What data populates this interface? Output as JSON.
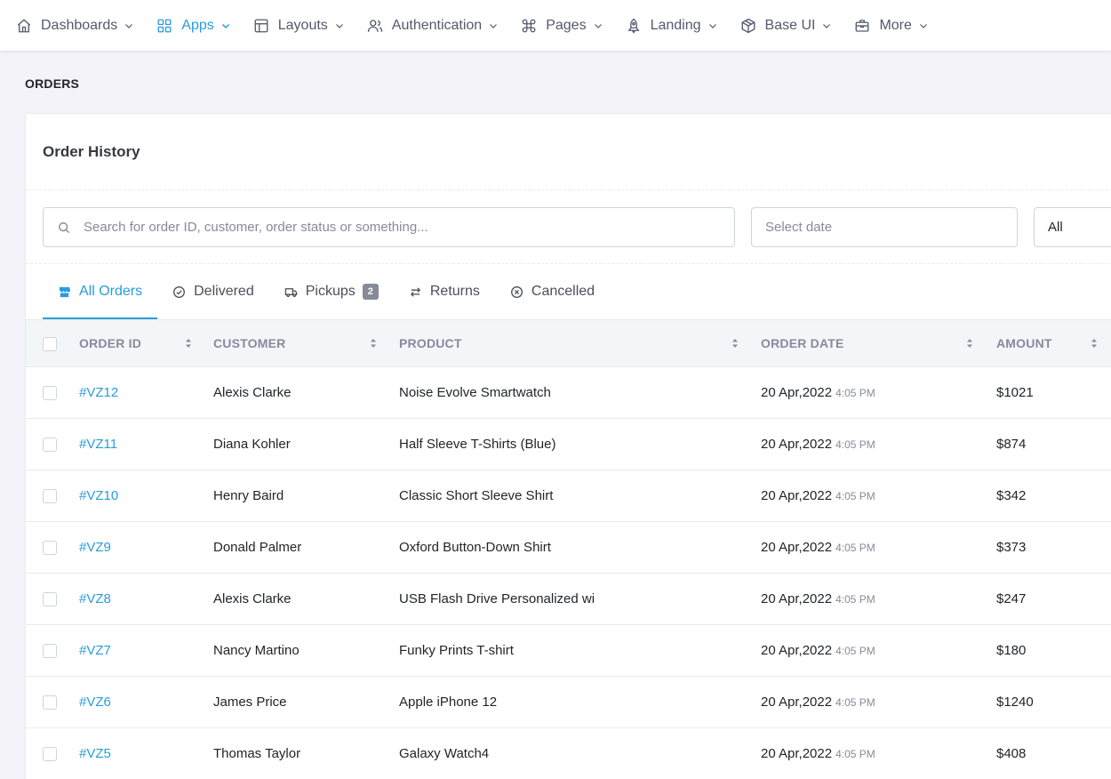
{
  "nav": {
    "items": [
      {
        "label": "Dashboards",
        "icon": "home-icon",
        "active": false
      },
      {
        "label": "Apps",
        "icon": "grid-icon",
        "active": true
      },
      {
        "label": "Layouts",
        "icon": "layout-icon",
        "active": false
      },
      {
        "label": "Authentication",
        "icon": "users-icon",
        "active": false
      },
      {
        "label": "Pages",
        "icon": "command-icon",
        "active": false
      },
      {
        "label": "Landing",
        "icon": "rocket-icon",
        "active": false
      },
      {
        "label": "Base UI",
        "icon": "cube-icon",
        "active": false
      },
      {
        "label": "More",
        "icon": "briefcase-icon",
        "active": false
      }
    ]
  },
  "page": {
    "title": "ORDERS"
  },
  "card": {
    "title": "Order History"
  },
  "filters": {
    "search_placeholder": "Search for order ID, customer, order status or something...",
    "date_placeholder": "Select date",
    "status_value": "All"
  },
  "tabs": [
    {
      "label": "All Orders",
      "icon": "store-icon",
      "active": true
    },
    {
      "label": "Delivered",
      "icon": "check-circle-icon",
      "active": false
    },
    {
      "label": "Pickups",
      "icon": "truck-icon",
      "active": false,
      "badge": "2"
    },
    {
      "label": "Returns",
      "icon": "arrow-left-right-icon",
      "active": false
    },
    {
      "label": "Cancelled",
      "icon": "close-circle-icon",
      "active": false
    }
  ],
  "table": {
    "columns": [
      "ORDER ID",
      "CUSTOMER",
      "PRODUCT",
      "ORDER DATE",
      "AMOUNT"
    ],
    "rows": [
      {
        "id": "#VZ12",
        "customer": "Alexis Clarke",
        "product": "Noise Evolve Smartwatch",
        "date": "20 Apr,2022",
        "time": "4:05 PM",
        "amount": "$1021"
      },
      {
        "id": "#VZ11",
        "customer": "Diana Kohler",
        "product": "Half Sleeve T-Shirts (Blue)",
        "date": "20 Apr,2022",
        "time": "4:05 PM",
        "amount": "$874"
      },
      {
        "id": "#VZ10",
        "customer": "Henry Baird",
        "product": "Classic Short Sleeve Shirt",
        "date": "20 Apr,2022",
        "time": "4:05 PM",
        "amount": "$342"
      },
      {
        "id": "#VZ9",
        "customer": "Donald Palmer",
        "product": "Oxford Button-Down Shirt",
        "date": "20 Apr,2022",
        "time": "4:05 PM",
        "amount": "$373"
      },
      {
        "id": "#VZ8",
        "customer": "Alexis Clarke",
        "product": "USB Flash Drive Personalized wi",
        "date": "20 Apr,2022",
        "time": "4:05 PM",
        "amount": "$247"
      },
      {
        "id": "#VZ7",
        "customer": "Nancy Martino",
        "product": "Funky Prints T-shirt",
        "date": "20 Apr,2022",
        "time": "4:05 PM",
        "amount": "$180"
      },
      {
        "id": "#VZ6",
        "customer": "James Price",
        "product": "Apple iPhone 12",
        "date": "20 Apr,2022",
        "time": "4:05 PM",
        "amount": "$1240"
      },
      {
        "id": "#VZ5",
        "customer": "Thomas Taylor",
        "product": "Galaxy Watch4",
        "date": "20 Apr,2022",
        "time": "4:05 PM",
        "amount": "$408"
      }
    ]
  },
  "colors": {
    "accent": "#299cdb",
    "muted": "#878a99",
    "header_bg": "#f3f6f9",
    "page_bg": "#f3f3f9"
  }
}
